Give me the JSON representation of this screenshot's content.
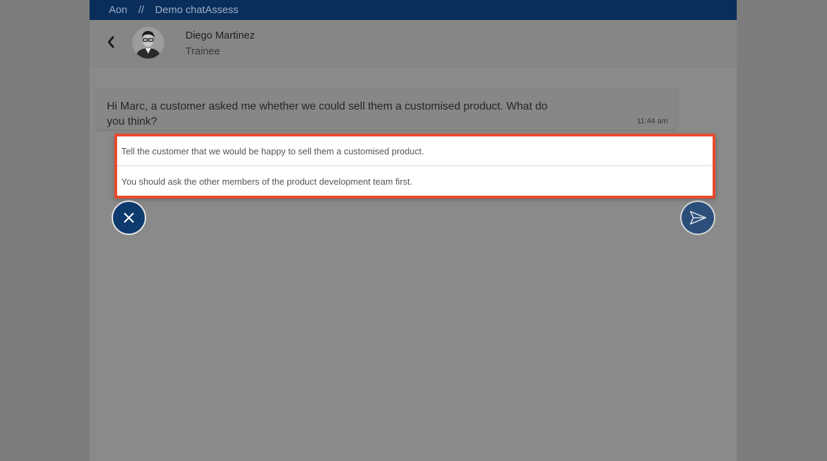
{
  "topbar": {
    "brand": "Aon",
    "separator": "//",
    "title": "Demo chatAssess"
  },
  "header": {
    "back_icon": "chevron-left-icon",
    "contact_name": "Diego Martinez",
    "contact_role": "Trainee"
  },
  "message": {
    "text": "Hi Marc, a customer asked me whether we could sell them a customised product. What do you think?",
    "time": "11:44 am"
  },
  "options": [
    {
      "label": "Tell the customer that we would be happy to sell them a customised product."
    },
    {
      "label": "You should ask the other members of the product development team first."
    }
  ],
  "actions": {
    "cancel_icon": "close-icon",
    "send_icon": "send-icon"
  },
  "colors": {
    "topbar": "#0a2e5c",
    "highlight_border": "#ea4a2c",
    "cancel_button": "#0e3a6e",
    "send_button": "#2c4f7a"
  }
}
